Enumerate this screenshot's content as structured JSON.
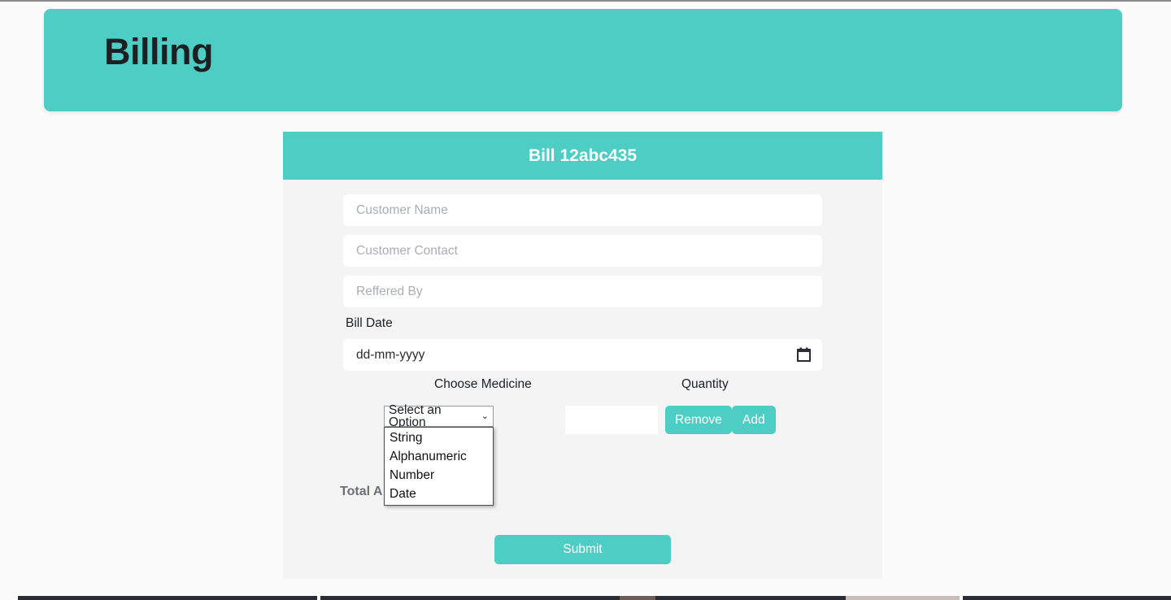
{
  "page": {
    "title": "Billing"
  },
  "bill_card": {
    "header_title": "Bill 12abc435",
    "fields": {
      "customer_name_placeholder": "Customer Name",
      "customer_contact_placeholder": "Customer Contact",
      "referred_by_placeholder": "Reffered By",
      "bill_date_label": "Bill Date",
      "bill_date_placeholder": "dd-mm-yyyy",
      "bill_date_value": ""
    },
    "item_row": {
      "medicine_label": "Choose Medicine",
      "quantity_label": "Quantity",
      "select_value": "Select an Option",
      "caret_glyph": "⌄",
      "quantity_value": "",
      "remove_label": "Remove",
      "add_label": "Add"
    },
    "dropdown": {
      "open": true,
      "options": [
        "String",
        "Alphanumeric",
        "Number",
        "Date"
      ]
    },
    "total_amount_label": "Total A",
    "submit_label": "Submit"
  },
  "colors": {
    "accent_teal": "#4ecdc4",
    "card_background": "#f4f4f4",
    "page_background": "#fbfbfb",
    "header_text": "#ffffff",
    "title_text": "#1c2023",
    "placeholder_text": "#a9aeb3",
    "total_text": "#6d7175"
  }
}
